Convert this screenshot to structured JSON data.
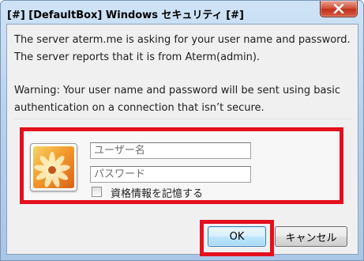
{
  "window": {
    "title": "[#] [DefaultBox] Windows セキュリティ [#]",
    "close_icon": "close-icon"
  },
  "message": {
    "line1": "The server aterm.me is asking for your user name and password. The server reports that it is from Aterm(admin).",
    "line2": "Warning: Your user name and password will be sent using basic authentication on a connection that isn’t secure."
  },
  "credentials": {
    "avatar_icon": "user-tile-icon",
    "username": {
      "value": "",
      "placeholder": "ユーザー名"
    },
    "password": {
      "value": "",
      "placeholder": "パスワード"
    },
    "remember": {
      "label": "資格情報を記憶する",
      "checked": false
    }
  },
  "buttons": {
    "ok_label": "OK",
    "cancel_label": "キャンセル"
  },
  "colors": {
    "highlight": "#e3101e",
    "title_bar": "#b9d3ee",
    "client_bg": "#f0f0f0"
  }
}
